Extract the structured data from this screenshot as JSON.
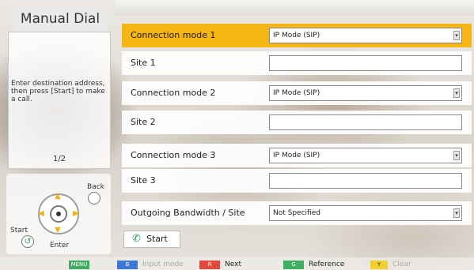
{
  "left": {
    "title": "Manual Dial",
    "help_text": "Enter destination address, then press [Start] to make a call.",
    "page_indicator": "1/2",
    "remote": {
      "back_label": "Back",
      "start_label": "Start",
      "enter_label": "Enter"
    }
  },
  "form": {
    "rows": [
      {
        "label": "Connection mode 1",
        "type": "select",
        "value": "IP Mode (SIP)",
        "selected": true
      },
      {
        "label": "Site 1",
        "type": "text",
        "value": ""
      },
      {
        "label": "Connection mode 2",
        "type": "select",
        "value": "IP Mode (SIP)"
      },
      {
        "label": "Site 2",
        "type": "text",
        "value": ""
      },
      {
        "label": "Connection mode 3",
        "type": "select",
        "value": "IP Mode (SIP)"
      },
      {
        "label": "Site 3",
        "type": "text",
        "value": ""
      },
      {
        "label": "Outgoing Bandwidth / Site",
        "type": "select",
        "value": "Not Specified"
      }
    ],
    "start_button": "Start"
  },
  "bottom_bar": {
    "menu_key": "MENU",
    "keys": [
      {
        "key": "B",
        "label": "Input mode",
        "color": "#3c78d8",
        "enabled": false
      },
      {
        "key": "R",
        "label": "Next",
        "color": "#e0493b",
        "enabled": true
      },
      {
        "key": "G",
        "label": "Reference",
        "color": "#3fae62",
        "enabled": true
      },
      {
        "key": "Y",
        "label": "Clear",
        "color": "#f0d030",
        "enabled": false
      }
    ]
  },
  "colors": {
    "selection": "#f5b514",
    "accent_green": "#3fae62"
  }
}
